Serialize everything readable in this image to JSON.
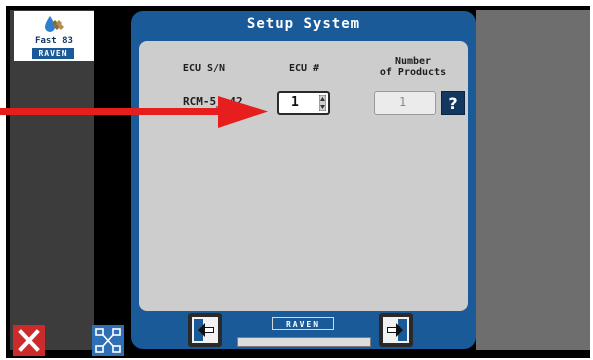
{
  "app": {
    "logo_text": "Fast 83",
    "logo_brand": "RAVEN"
  },
  "dialog": {
    "title": "Setup System",
    "headers": {
      "ecu_sn": "ECU S/N",
      "ecu_num": "ECU #",
      "num_products": [
        "Number",
        "of Products"
      ]
    },
    "ecu_sn_value": "RCM-5__42",
    "ecu_num_value": "1",
    "num_products_value": "1",
    "help_label": "?",
    "footer_brand": "RAVEN"
  },
  "icons": {
    "close": "close-icon",
    "layout": "layout-icon",
    "back": "back-arrow-icon",
    "next": "next-arrow-icon",
    "spinner": "up-down-spinner-icon"
  },
  "colors": {
    "dialog_blue": "#1a5a98",
    "dark_blue": "#12385f",
    "close_red": "#cc2b2b",
    "annotation_arrow": "#e61e1e"
  }
}
